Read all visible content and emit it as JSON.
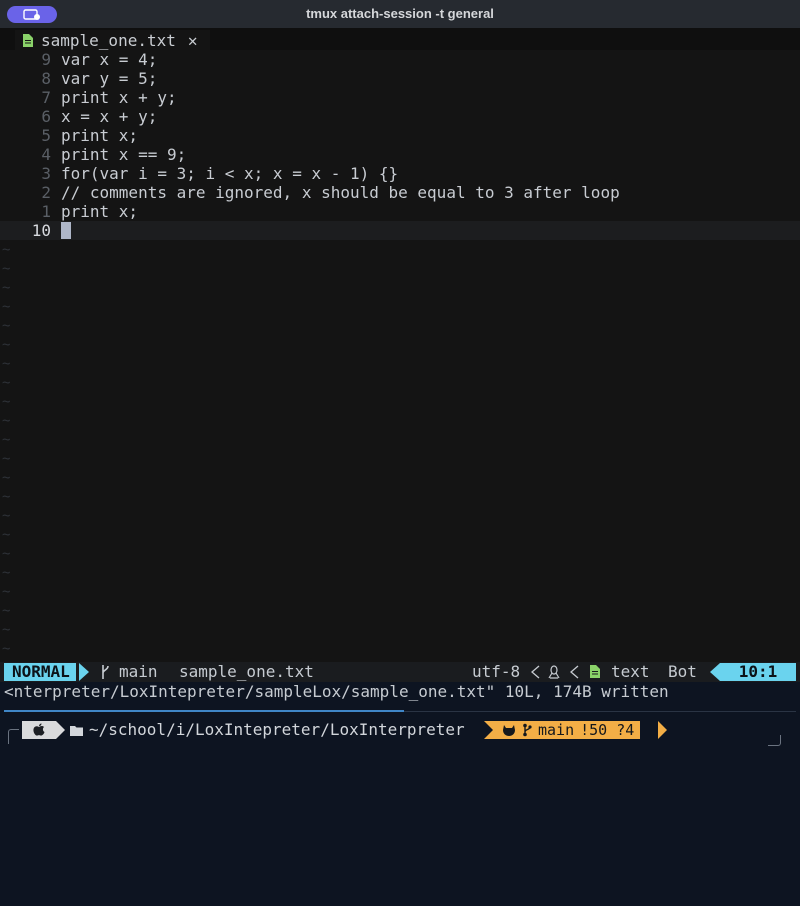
{
  "window": {
    "title": "tmux attach-session -t general"
  },
  "tab": {
    "filename": "sample_one.txt",
    "close": "✕",
    "icon": "file-icon"
  },
  "editor": {
    "lines": [
      {
        "num": "9",
        "code": "var x = 4;"
      },
      {
        "num": "8",
        "code": "var y = 5;"
      },
      {
        "num": "7",
        "code": "print x + y;"
      },
      {
        "num": "6",
        "code": "x = x + y;"
      },
      {
        "num": "5",
        "code": "print x;"
      },
      {
        "num": "4",
        "code": "print x == 9;"
      },
      {
        "num": "3",
        "code": "for(var i = 3; i < x; x = x - 1) {}"
      },
      {
        "num": "2",
        "code": "// comments are ignored, x should be equal to 3 after loop"
      },
      {
        "num": "1",
        "code": "print x;"
      },
      {
        "num": "10",
        "code": ""
      }
    ],
    "tilde": "~"
  },
  "statusline": {
    "mode": "NORMAL",
    "branch": "main",
    "filename": "sample_one.txt",
    "encoding": "utf-8",
    "filetype": "text",
    "scroll": "Bot",
    "position": "10:1"
  },
  "cmdline": {
    "text": "<nterpreter/LoxIntepreter/sampleLox/sample_one.txt\" 10L, 174B written"
  },
  "prompt": {
    "path": "~/school/i/LoxIntepreter/LoxInterpreter",
    "branch": "main",
    "status": "!50 ?4"
  },
  "colors": {
    "accent": "#6ad3ee",
    "git": "#f3ae46",
    "pill": "#6a63e8",
    "file": "#8bd36a"
  }
}
